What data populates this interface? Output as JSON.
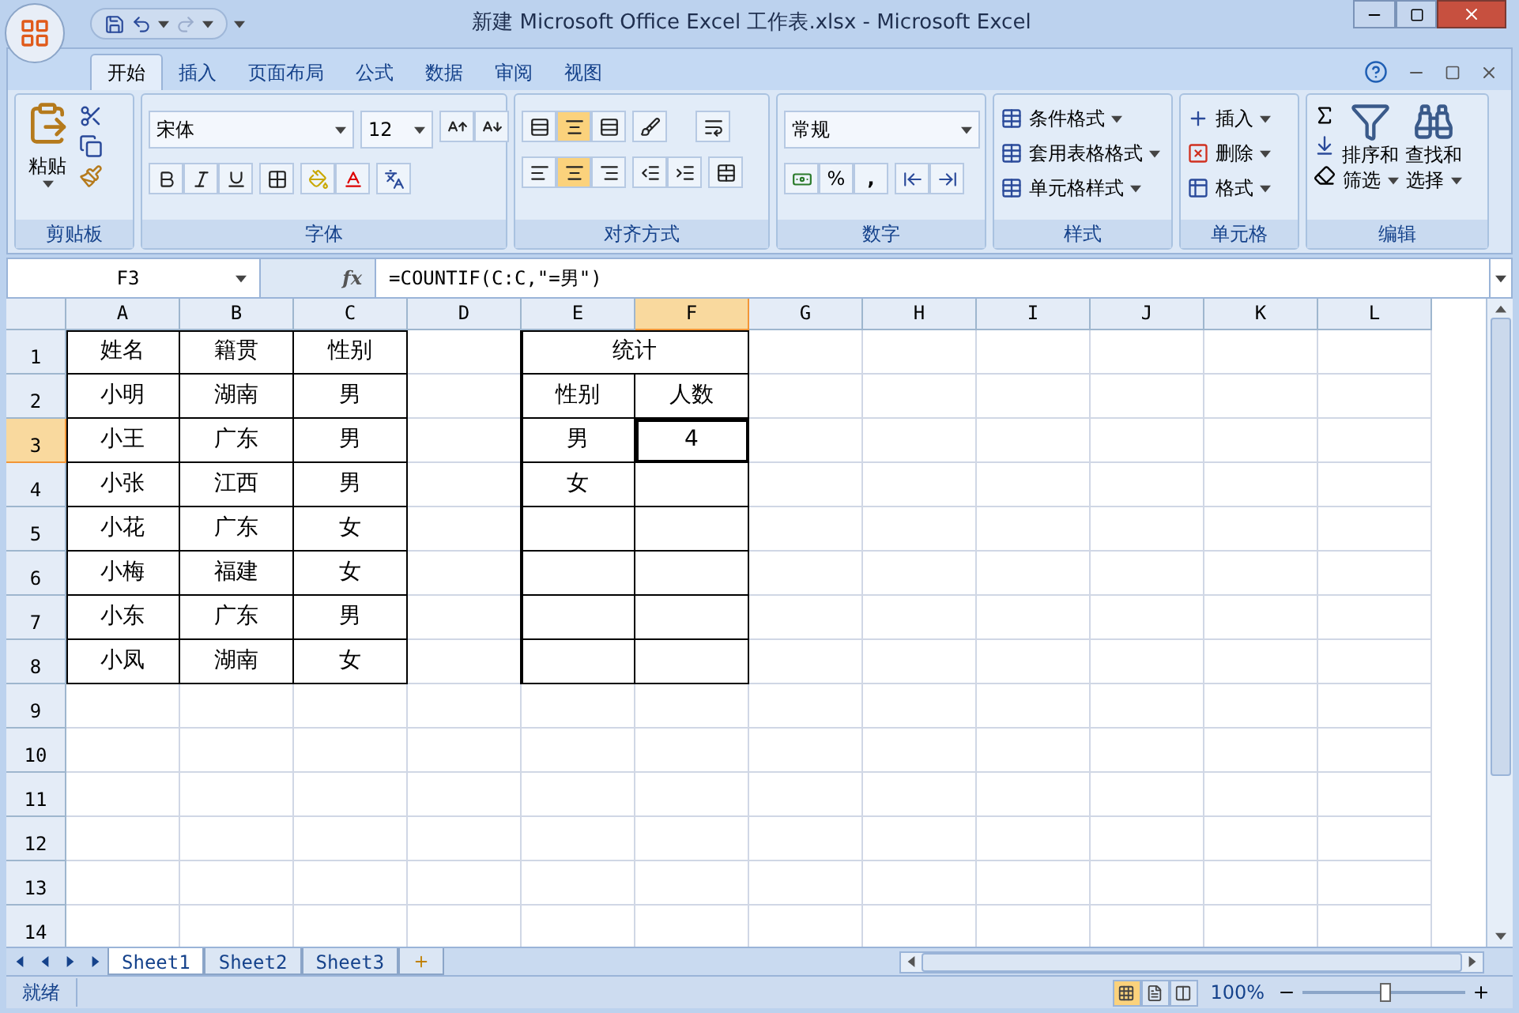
{
  "window": {
    "title": "新建 Microsoft Office Excel 工作表.xlsx - Microsoft Excel"
  },
  "tabs": [
    {
      "label": "开始",
      "selected": true
    },
    {
      "label": "插入",
      "selected": false
    },
    {
      "label": "页面布局",
      "selected": false
    },
    {
      "label": "公式",
      "selected": false
    },
    {
      "label": "数据",
      "selected": false
    },
    {
      "label": "审阅",
      "selected": false
    },
    {
      "label": "视图",
      "selected": false
    }
  ],
  "ribbon": {
    "clipboard": {
      "label": "剪贴板",
      "paste": "粘贴"
    },
    "font": {
      "label": "字体",
      "font_name": "宋体",
      "font_size": "12"
    },
    "alignment": {
      "label": "对齐方式",
      "vertical": [
        {
          "kind": "top",
          "selected": false
        },
        {
          "kind": "middle",
          "selected": true
        },
        {
          "kind": "bottom",
          "selected": false
        }
      ],
      "horizontal": [
        {
          "kind": "left",
          "selected": false
        },
        {
          "kind": "center",
          "selected": true
        },
        {
          "kind": "right",
          "selected": false
        }
      ]
    },
    "number": {
      "label": "数字",
      "format": "常规",
      "percent": "%",
      "comma": ","
    },
    "styles": {
      "label": "样式",
      "buttons": [
        "条件格式",
        "套用表格格式",
        "单元格样式"
      ]
    },
    "cells": {
      "label": "单元格",
      "buttons": [
        {
          "kind": "insert",
          "label": "插入"
        },
        {
          "kind": "delete",
          "label": "删除"
        },
        {
          "kind": "format",
          "label": "格式"
        }
      ]
    },
    "editing": {
      "label": "编辑",
      "buttons": [
        {
          "kind": "sort",
          "lines": [
            "排序和",
            "筛选"
          ]
        },
        {
          "kind": "find",
          "lines": [
            "查找和",
            "选择"
          ]
        }
      ]
    }
  },
  "formula_bar": {
    "name_box": "F3",
    "function_label": "fx",
    "formula": "=COUNTIF(C:C,\"=男\")"
  },
  "sheet": {
    "columns": [
      {
        "label": "A",
        "selected": false
      },
      {
        "label": "B",
        "selected": false
      },
      {
        "label": "C",
        "selected": false
      },
      {
        "label": "D",
        "selected": false
      },
      {
        "label": "E",
        "selected": false
      },
      {
        "label": "F",
        "selected": true
      },
      {
        "label": "G",
        "selected": false
      },
      {
        "label": "H",
        "selected": false
      },
      {
        "label": "I",
        "selected": false
      },
      {
        "label": "J",
        "selected": false
      },
      {
        "label": "K",
        "selected": false
      },
      {
        "label": "L",
        "selected": false
      }
    ],
    "rows": [
      {
        "label": "1",
        "selected": false,
        "cells": {
          "A": "姓名",
          "B": "籍贯",
          "C": "性别",
          "E": "统计"
        }
      },
      {
        "label": "2",
        "selected": false,
        "cells": {
          "A": "小明",
          "B": "湖南",
          "C": "男",
          "E": "性别",
          "F": "人数"
        }
      },
      {
        "label": "3",
        "selected": true,
        "cells": {
          "A": "小王",
          "B": "广东",
          "C": "男",
          "E": "男",
          "F": "4"
        }
      },
      {
        "label": "4",
        "selected": false,
        "cells": {
          "A": "小张",
          "B": "江西",
          "C": "男",
          "E": "女"
        }
      },
      {
        "label": "5",
        "selected": false,
        "cells": {
          "A": "小花",
          "B": "广东",
          "C": "女"
        }
      },
      {
        "label": "6",
        "selected": false,
        "cells": {
          "A": "小梅",
          "B": "福建",
          "C": "女"
        }
      },
      {
        "label": "7",
        "selected": false,
        "cells": {
          "A": "小东",
          "B": "广东",
          "C": "男"
        }
      },
      {
        "label": "8",
        "selected": false,
        "cells": {
          "A": "小凤",
          "B": "湖南",
          "C": "女"
        }
      },
      {
        "label": "9",
        "selected": false,
        "cells": {}
      },
      {
        "label": "10",
        "selected": false,
        "cells": {}
      },
      {
        "label": "11",
        "selected": false,
        "cells": {}
      },
      {
        "label": "12",
        "selected": false,
        "cells": {}
      },
      {
        "label": "13",
        "selected": false,
        "cells": {}
      },
      {
        "label": "14",
        "selected": false,
        "cells": {}
      }
    ]
  },
  "sheet_tabs": [
    {
      "label": "Sheet1",
      "selected": true
    },
    {
      "label": "Sheet2",
      "selected": false
    },
    {
      "label": "Sheet3",
      "selected": false
    }
  ],
  "status_bar": {
    "status": "就绪",
    "zoom": "100%",
    "zoom_slider": {
      "level": 0.5
    },
    "views": [
      {
        "kind": "normal",
        "selected": true
      },
      {
        "kind": "page_layout",
        "selected": false
      },
      {
        "kind": "page_break",
        "selected": false
      }
    ]
  }
}
